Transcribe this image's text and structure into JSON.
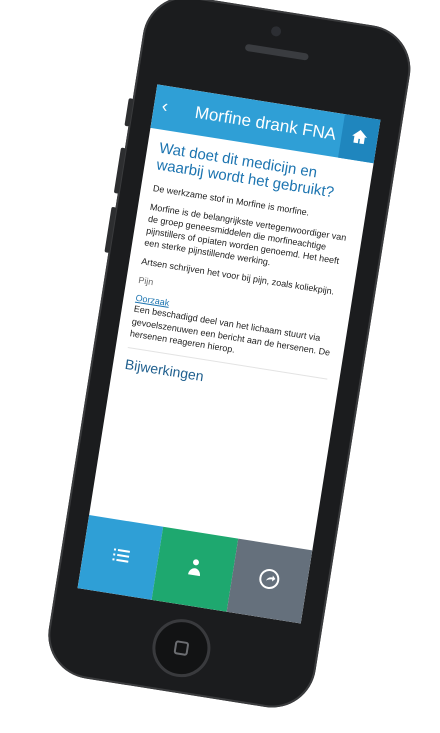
{
  "header": {
    "back_icon": "chevron-left-icon",
    "title": "Morfine drank FNA",
    "home_icon": "home-icon"
  },
  "content": {
    "question": "Wat doet dit medicijn en waarbij wordt het gebruikt?",
    "paragraph1": "De werkzame stof in Morfine is morfine.",
    "paragraph2": "Morfine is de belangrijkste vertegenwoordiger van de groep geneesmiddelen die morfineachtige pijnstillers of opiaten worden genoemd. Het heeft een sterke pijnstillende werking.",
    "paragraph3": "Artsen schrijven het voor bij pijn, zoals koliekpijn.",
    "label_pain": "Pijn",
    "label_cause": "Oorzaak",
    "paragraph4": "Een beschadigd deel van het lichaam stuurt via gevoelszenuwen een bericht aan de hersenen. De hersenen reageren hierop."
  },
  "section": {
    "title": "Bijwerkingen"
  },
  "bottom_nav": {
    "items": [
      {
        "icon": "list-icon",
        "color": "#2f9fd6"
      },
      {
        "icon": "person-icon",
        "color": "#1ea86f"
      },
      {
        "icon": "share-icon",
        "color": "#65707c"
      }
    ]
  }
}
